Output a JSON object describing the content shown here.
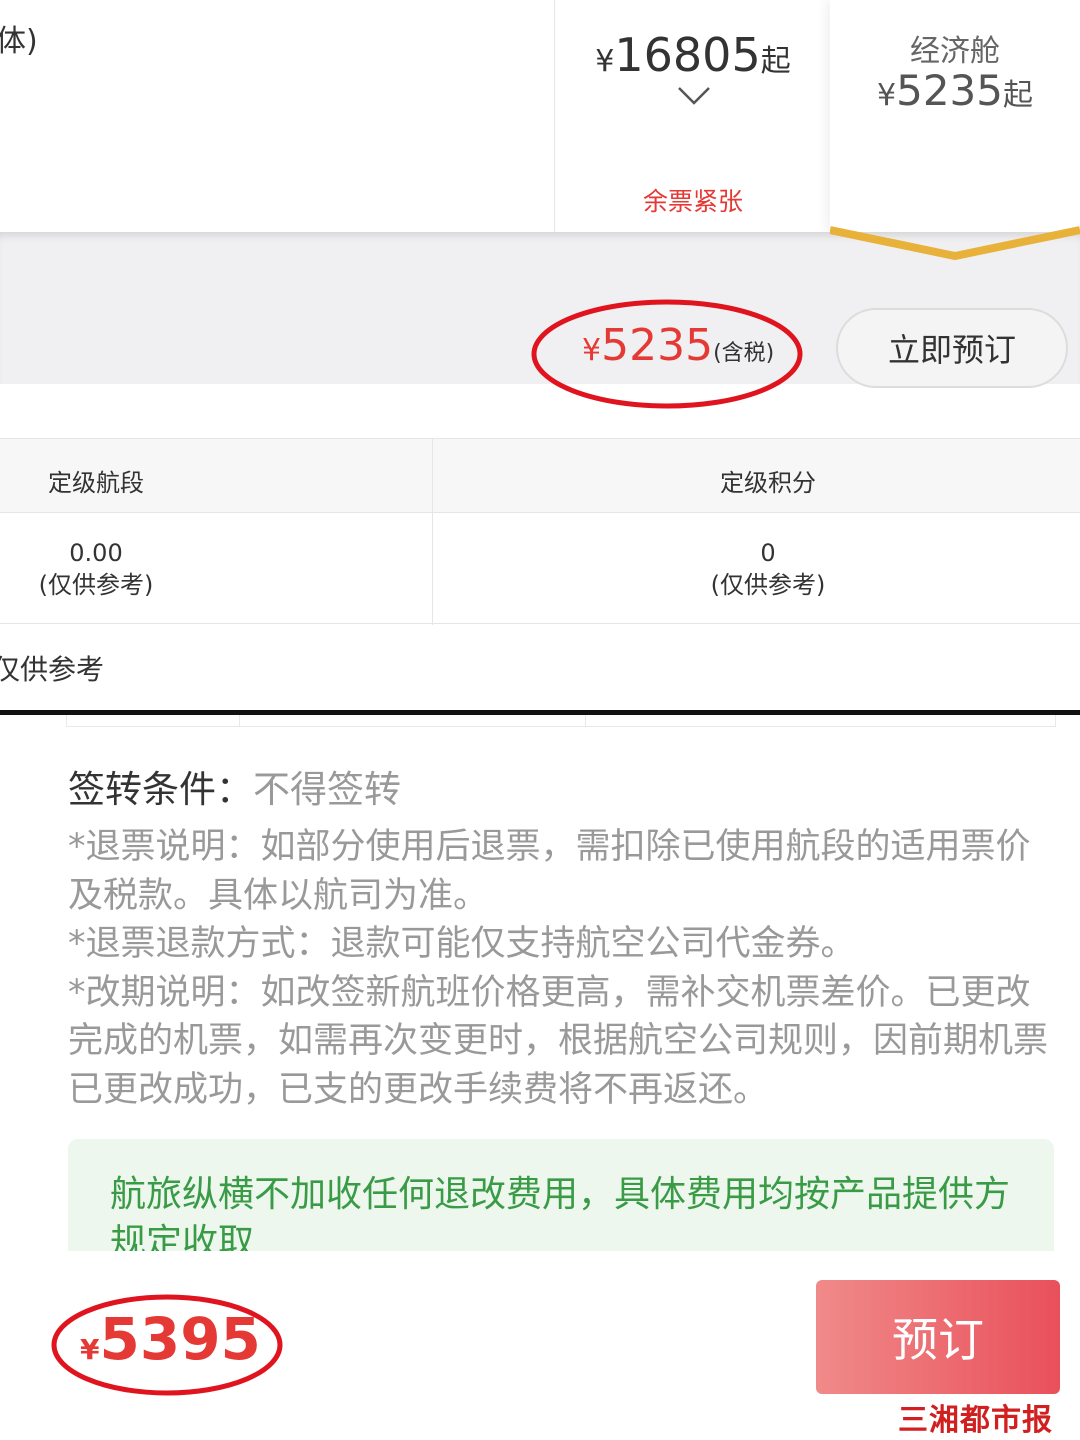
{
  "header": {
    "left_cut_text": "体)",
    "mid": {
      "yen": "¥",
      "price": "16805",
      "suffix": "起",
      "status": "余票紧张"
    },
    "right": {
      "cabin": "经济舱",
      "yen": "¥",
      "price": "5235",
      "suffix": "起"
    }
  },
  "fare_row": {
    "yen": "¥",
    "price": "5235",
    "tax_note": "(含税)",
    "book_now_label": "立即预订"
  },
  "points_table": {
    "headers": [
      "定级航段",
      "定级积分"
    ],
    "values": [
      "0.00",
      "0"
    ],
    "notes": [
      "(仅供参考)",
      "(仅供参考)"
    ]
  },
  "reference_note": "仅供参考",
  "endorse": {
    "label": "签转条件：",
    "value": "不得签转"
  },
  "rules": [
    "*退票说明：如部分使用后退票，需扣除已使用航段的适用票价及税款。具体以航司为准。",
    "*退票退款方式：退款可能仅支持航空公司代金券。",
    "*改期说明：如改签新航班价格更高，需补交机票差价。已更改完成的机票，如需再次变更时，根据航空公司规则，因前期机票已更改成功，已支的更改手续费将不再返还。"
  ],
  "notice": "航旅纵横不加收任何退改费用，具体费用均按产品提供方规定收取",
  "bottom_bar": {
    "yen": "¥",
    "total": "5395",
    "book_label": "预订"
  },
  "watermark": "三湘都市报",
  "colors": {
    "price_red": "#e53935",
    "notice_green": "#3a9b46",
    "notice_bg": "#edf7ee",
    "highlight_ring": "#e0141e",
    "gold": "#e8b23a"
  }
}
